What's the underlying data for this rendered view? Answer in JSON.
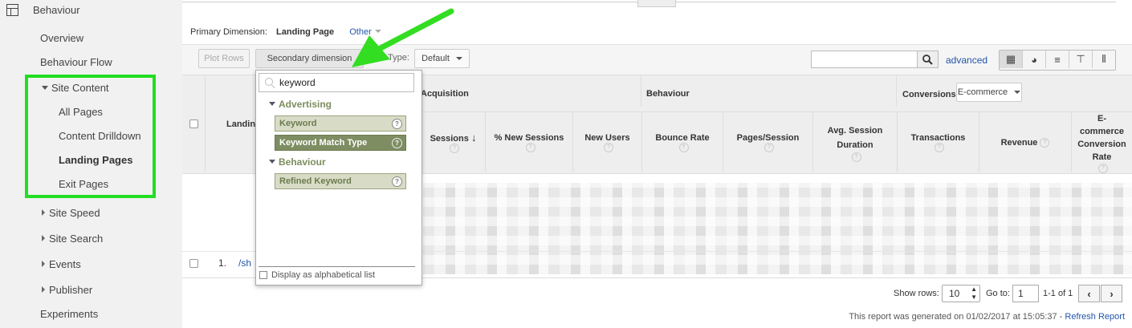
{
  "sidebar": {
    "title": "Behaviour",
    "items": [
      {
        "label": "Overview"
      },
      {
        "label": "Behaviour Flow"
      },
      {
        "label": "Site Content"
      },
      {
        "label": "All Pages"
      },
      {
        "label": "Content Drilldown"
      },
      {
        "label": "Landing Pages"
      },
      {
        "label": "Exit Pages"
      },
      {
        "label": "Site Speed"
      },
      {
        "label": "Site Search"
      },
      {
        "label": "Events"
      },
      {
        "label": "Publisher"
      },
      {
        "label": "Experiments"
      }
    ]
  },
  "toolbar": {
    "primary_label": "Primary Dimension:",
    "primary_value": "Landing Page",
    "other_label": "Other",
    "plot_rows": "Plot Rows",
    "secondary_dimension": "Secondary dimension",
    "sort_type_label": "Sort Type:",
    "sort_type_value": "Default",
    "advanced": "advanced"
  },
  "table": {
    "landing_header": "Landing",
    "groups": {
      "acquisition": "Acquisition",
      "behaviour": "Behaviour",
      "conversions": "Conversions",
      "ecommerce_select": "E-commerce"
    },
    "columns": [
      {
        "label": "Sessions"
      },
      {
        "label": "% New Sessions"
      },
      {
        "label": "New Users"
      },
      {
        "label": "Bounce Rate"
      },
      {
        "label": "Pages/Session"
      },
      {
        "label": "Avg. Session Duration"
      },
      {
        "label": "Transactions"
      },
      {
        "label": "Revenue"
      },
      {
        "label": "E-commerce Conversion Rate"
      }
    ],
    "row": {
      "index": "1.",
      "link": "/sh"
    }
  },
  "popup": {
    "search_value": "keyword",
    "groups": [
      {
        "label": "Advertising",
        "options": [
          "Keyword",
          "Keyword Match Type"
        ]
      },
      {
        "label": "Behaviour",
        "options": [
          "Refined Keyword"
        ]
      }
    ],
    "alphabetical": "Display as alphabetical list"
  },
  "footer": {
    "show_rows_label": "Show rows:",
    "show_rows_value": "10",
    "goto_label": "Go to:",
    "goto_value": "1",
    "range": "1-1 of 1",
    "generated": "This report was generated on 01/02/2017 at 15:05:37 -",
    "refresh": "Refresh Report"
  },
  "colors": {
    "highlight_box": "#22dd22",
    "arrow": "#33dd22",
    "link": "#2255aa"
  }
}
